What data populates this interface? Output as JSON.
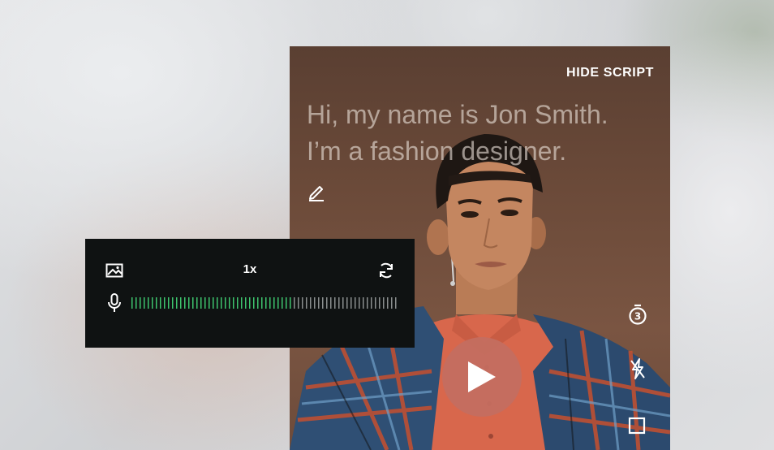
{
  "script_panel": {
    "hide_script_label": "HIDE SCRIPT",
    "script_line_1": "Hi, my name is Jon Smith.",
    "script_line_2": "I’m a fashion designer."
  },
  "recorder": {
    "speed_label": "1x",
    "audio_level": 0.6,
    "meter_colors": {
      "active": "#3ec46d",
      "inactive": "#8a8e8e"
    }
  },
  "icons": {
    "edit": "pencil-icon",
    "play": "play-icon",
    "timer": "timer-3-icon",
    "flash": "flash-off-icon",
    "stop": "stop-icon",
    "media": "image-icon",
    "flip": "flip-camera-icon",
    "mic": "microphone-icon"
  },
  "colors": {
    "play_button": "#c46e60",
    "panel_bg": "#0f1212"
  }
}
